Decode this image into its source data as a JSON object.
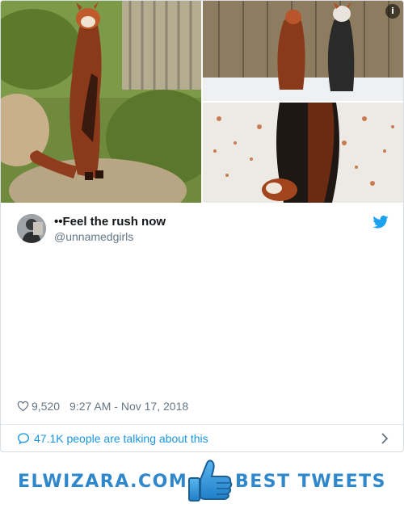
{
  "tweet": {
    "display_name": "⁣⁣⁣⁣⁣⁣⁣⁣•⁣•Feel the rush now",
    "handle": "@unnamedgirls",
    "body": "⁣⁣⁣⁣⁣⁣⁣⁣⁣⁣⁣⁣⁣⁣⁣⁣⁣⁣⁣⁣⁣⁣⁣⁣⁣⁣⁣⁣⁣⁣⁣⁣⁣⁣⁣⁣⁣⁣⁣⁣⁣⁣⁣⁣⁣⁣⁣⁣⁣⁣⁣⁣⁣⁣⁣⁣⁣⁣⁣⁣⁣⁣⁣⁣⁣⁣⁣⁣⁣⁣⁣⁣⁣⁣⁣⁣⁣⁣⁣⁣⁣⁣⁣⁣⁣⁣⁣⁣⁣⁣⁣⁣⁣⁣ ⁣⁣⁣ ⁣⁣⁣⁣ ⁣⁣⁣⁣⁣⁣⁣ ⁣⁣⁣⁣⁣⁣⁣⁣⁣⁣⁣⁣⁣⁣⁣⁣⁣⁣⁣⁣⁣⁣⁣⁣⁣⁣⁣⁣⁣⁣⁣⁣⁣ ⁣⁣⁣⁣⁣⁣ ⁣⁣⁣⁣⁣⁣⁣⁣⁣⁣⁣⁣⁣⁣⁣⁣⁣⁣⁣⁣⁣⁣⁣⁣⁣⁣⁣⁣⁣⁣⁣⁣⁣⁣⁣⁣⁣⁣⁣⁣⁣⁣⁣⁣⁣⁣⁣⁣⁣⁣⁣⁣⁣⁣⁣⁣⁣⁣⁣⁣⁣⁣⁣⁣⁣⁣⁣⁣⁣⁣⁣⁣⁣⁣⁣⁣⁣⁣⁣⁣⁣⁣⁣⁣⁣⁣⁣⁣⁣⁣⁣⁣⁣⁣⁣⁣⁣⁣⁣⁣⁣⁣⁣⁣⁣⁣⁣⁣⁣⁣⁣⁣⁣⁣⁣⁣⁣⁣⁣⁣⁣⁣⁣⁣⁣⁣⁣⁣⁣⁣⁣⁣⁣⁣⁣⁣⁣⁣⁣⁣⁣⁣⁣⁣⁣⁣⁣⁣⁣⁣⁣⁣⁣⁣⁣⁣⁣⁣⁣⁣⁣⁣⁣ ⁣⁣⁣⁣⁣⁣⁣⁣⁣⁣⁣⁣⁣⁣⁣⁣⁣⁣⁣ ⁣⁣⁣⁣⁣⁣⁣⁣",
    "likes": "9,520",
    "timestamp": "9:27 AM - Nov 17, 2018",
    "talking": "47.1K people are talking about this"
  },
  "banner": {
    "left_text": "ELWIZARA.COM",
    "right_text": "BEST TWEETS"
  },
  "icons": {
    "info": "info-icon",
    "bird": "twitter-bird-icon",
    "heart": "heart-icon",
    "bubble": "comment-bubble-icon",
    "chevron": "chevron-right-icon",
    "thumbs": "thumbs-up-icon"
  },
  "colors": {
    "twitter_blue": "#1da1f2",
    "link_blue": "#1b95e0",
    "muted_text": "#657786",
    "banner_blue": "#2f87cc"
  }
}
